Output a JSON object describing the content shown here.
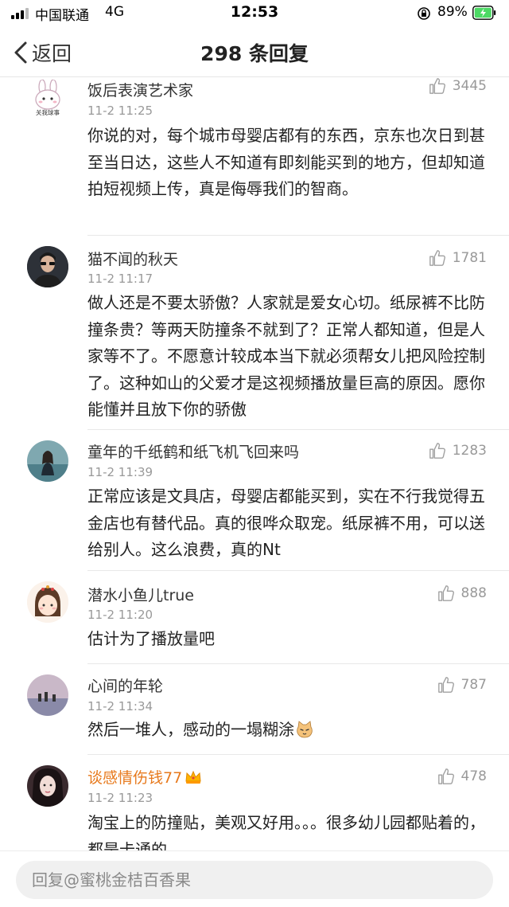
{
  "status_bar": {
    "carrier": "中国联通",
    "network": "4G",
    "time": "12:53",
    "battery_percent": "89%"
  },
  "nav": {
    "back_label": "返回",
    "title": "298 条回复"
  },
  "comments": [
    {
      "username": "饭后表演艺术家",
      "time": "11-2 11:25",
      "likes": "3445",
      "text": "你说的对，每个城市母婴店都有的东西，京东也次日到甚至当日达，这些人不知道有即刻能买到的地方，但却知道拍短视频上传，真是侮辱我们的智商。",
      "avatar_text": "关我球事"
    },
    {
      "username": "猫不闻的秋天",
      "time": "11-2 11:17",
      "likes": "1781",
      "text": "做人还是不要太骄傲？人家就是爱女心切。纸尿裤不比防撞条贵？等两天防撞条不就到了？正常人都知道，但是人家等不了。不愿意计较成本当下就必须帮女儿把风险控制了。这种如山的父爱才是这视频播放量巨高的原因。愿你能懂并且放下你的骄傲"
    },
    {
      "username": "童年的千纸鹤和纸飞机飞回来吗",
      "time": "11-2 11:39",
      "likes": "1283",
      "text": "正常应该是文具店，母婴店都能买到，实在不行我觉得五金店也有替代品。真的很哗众取宠。纸尿裤不用，可以送给别人。这么浪费，真的Nt"
    },
    {
      "username": "潜水小鱼儿true",
      "time": "11-2 11:20",
      "likes": "888",
      "text": "估计为了播放量吧"
    },
    {
      "username": "心间的年轮",
      "time": "11-2 11:34",
      "likes": "787",
      "text": "然后一堆人，感动的一塌糊涂"
    },
    {
      "username": "谈感情伤钱77",
      "time": "11-2 11:23",
      "likes": "478",
      "text": "淘宝上的防撞贴，美观又好用。。。很多幼儿园都贴着的，都是卡通的"
    }
  ],
  "reply_bar": {
    "placeholder": "回复@蜜桃金桔百香果"
  },
  "colors": {
    "vip_name": "#e7791c",
    "meta_gray": "#999999",
    "separator": "#e8e8e8"
  },
  "icons": [
    "signal-icon",
    "lock-rotation-icon",
    "battery-charging-icon",
    "back-chevron-icon",
    "thumb-up-icon",
    "crown-icon",
    "cat-emoji-icon"
  ]
}
